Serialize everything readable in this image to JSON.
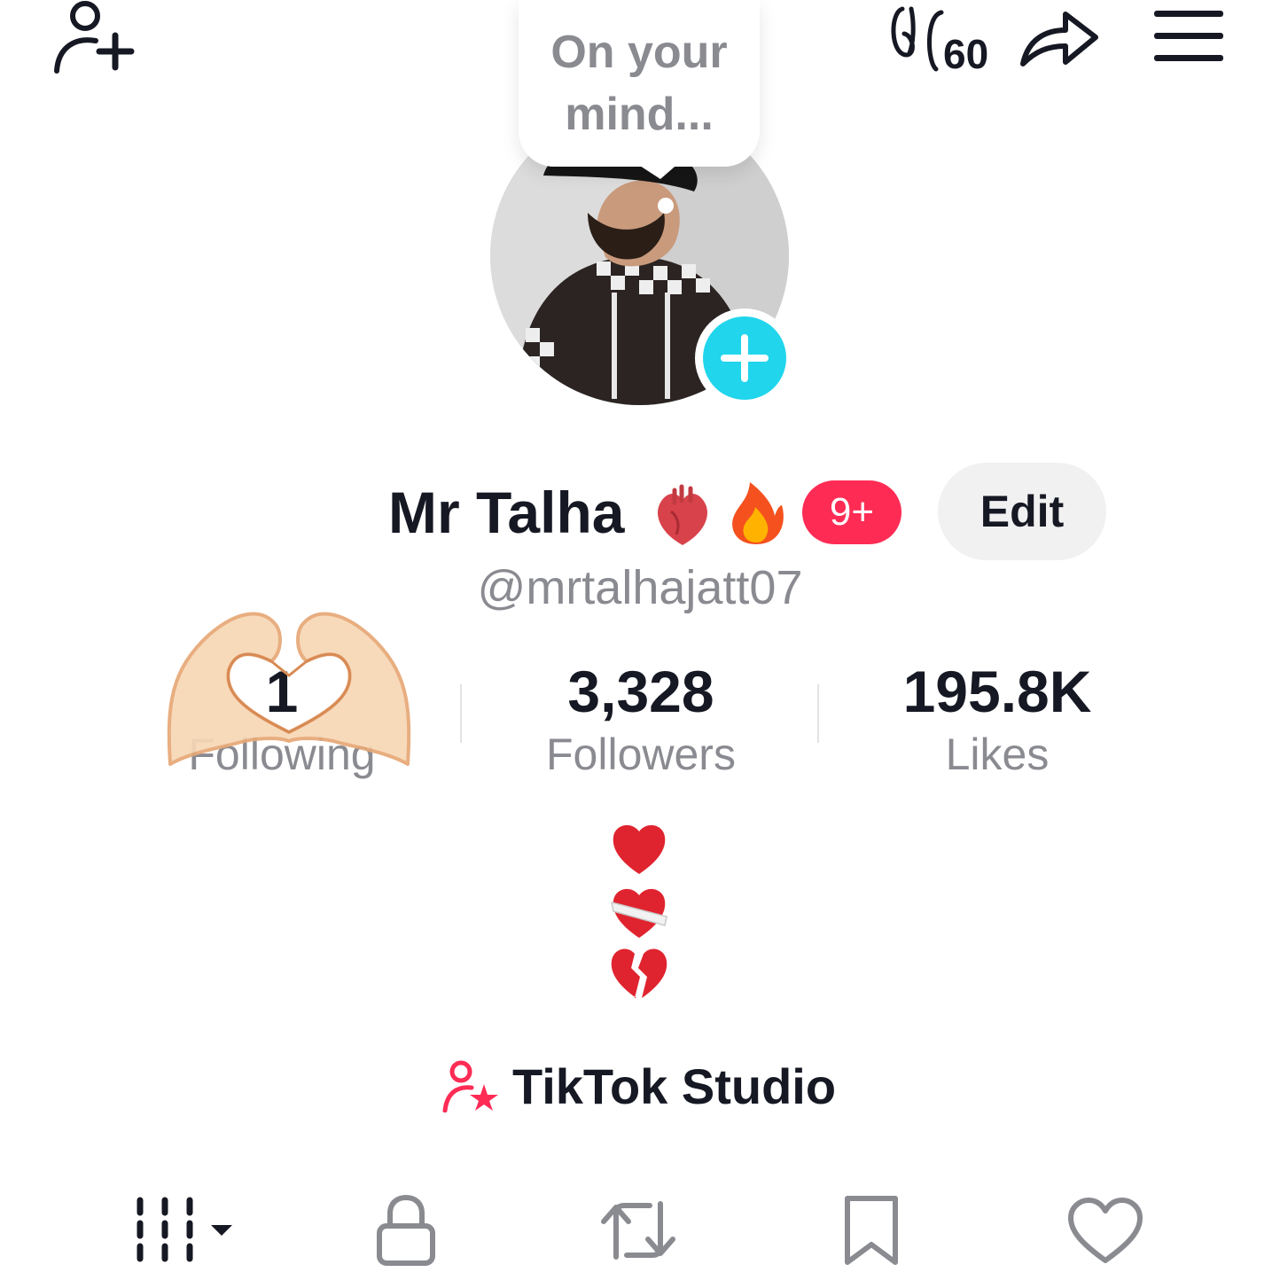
{
  "topbar": {
    "add_friend_icon": "person-plus-icon",
    "badge_icon": "scribble-60-icon",
    "badge_count": "60",
    "share_icon": "share-arrow-icon",
    "menu_icon": "hamburger-menu-icon"
  },
  "note": {
    "text": "On your mind..."
  },
  "profile": {
    "name": "Mr Talha",
    "name_emojis": [
      "anatomical-heart-emoji",
      "fire-emoji"
    ],
    "notification_badge": "9+",
    "edit_label": "Edit",
    "handle": "@mrtalhajatt07"
  },
  "stats": [
    {
      "value": "1",
      "label": "Following"
    },
    {
      "value": "3,328",
      "label": "Followers"
    },
    {
      "value": "195.8K",
      "label": "Likes"
    }
  ],
  "bio_emojis": [
    "red-heart-emoji",
    "mending-heart-emoji",
    "broken-heart-emoji"
  ],
  "studio": {
    "label": "TikTok Studio",
    "icon": "person-star-icon"
  },
  "tabs": [
    {
      "icon": "grid-dropdown-icon"
    },
    {
      "icon": "lock-icon"
    },
    {
      "icon": "repost-icon"
    },
    {
      "icon": "bookmark-icon"
    },
    {
      "icon": "heart-outline-icon"
    }
  ],
  "colors": {
    "accent_red": "#fe2c55",
    "accent_cyan": "#20d5ec",
    "text_primary": "#161823",
    "text_secondary": "#8a8b91"
  }
}
